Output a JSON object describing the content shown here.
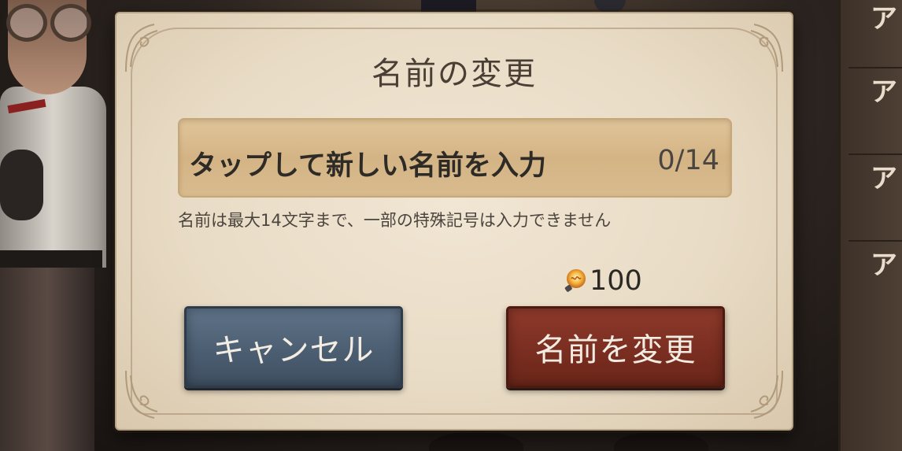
{
  "dialog": {
    "title": "名前の変更",
    "name_input": {
      "placeholder": "タップして新しい名前を入力",
      "counter": "0/14"
    },
    "hint": "名前は最大14文字まで、一部の特殊記号は入力できません",
    "cost": {
      "icon": "lightbulb-icon",
      "value": "100"
    },
    "buttons": {
      "cancel_label": "キャンセル",
      "confirm_label": "名前を変更"
    }
  },
  "side_tabs": [
    "ア",
    "ア",
    "ア",
    "ア"
  ],
  "colors": {
    "parchment": "#ede2cf",
    "input_fill": "#d8bb8e",
    "cancel_button": "#4c5e72",
    "confirm_button": "#7a2e21",
    "title_text": "#4a3f35"
  }
}
